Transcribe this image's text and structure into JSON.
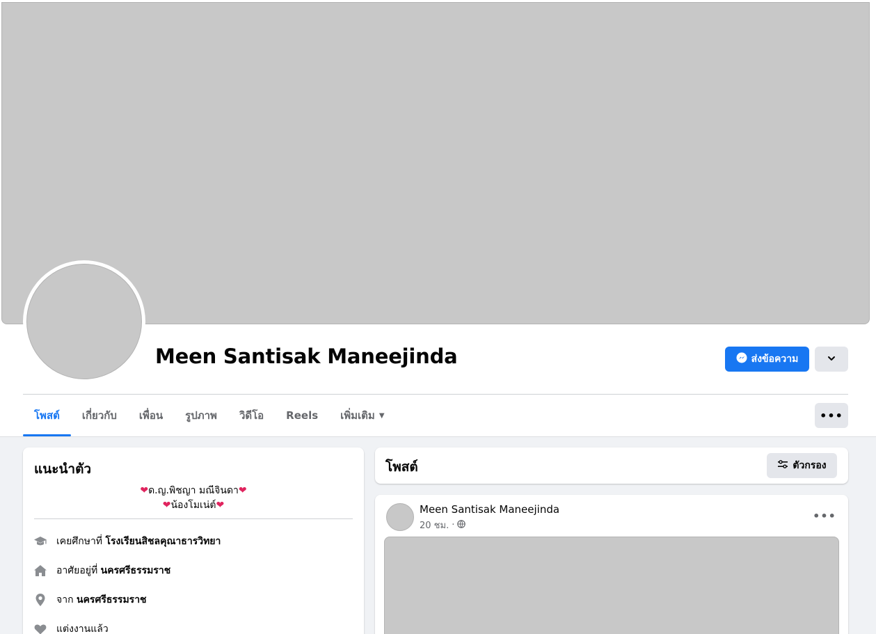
{
  "profile": {
    "name": "Meen Santisak Maneejinda",
    "message_button": "ส่งข้อความ",
    "cover_label": "Cover photo",
    "avatar_label": "Profile picture"
  },
  "tabs": [
    {
      "label": "โพสต์",
      "active": true
    },
    {
      "label": "เกี่ยวกับ",
      "active": false
    },
    {
      "label": "เพื่อน",
      "active": false
    },
    {
      "label": "รูปภาพ",
      "active": false
    },
    {
      "label": "วิดีโอ",
      "active": false
    },
    {
      "label": "Reels",
      "active": false
    },
    {
      "label": "เพิ่มเติม",
      "active": false
    }
  ],
  "intro": {
    "title": "แนะนำตัว",
    "bio_line1": "ด.ญ.พิชญา มณีจินดา",
    "bio_line2": "น้องโมเน่ต์",
    "rows": [
      {
        "icon": "education-icon",
        "prefix": "เคยศึกษาที่",
        "value": "โรงเรียนสิชลคุณาธารวิทยา"
      },
      {
        "icon": "home-icon",
        "prefix": "อาศัยอยู่ที่",
        "value": "นครศรีธรรมราช"
      },
      {
        "icon": "location-pin-icon",
        "prefix": "จาก",
        "value": "นครศรีธรรมราช"
      },
      {
        "icon": "heart-icon",
        "prefix": "แต่งงานแล้ว",
        "value": ""
      }
    ]
  },
  "posts": {
    "title": "โพสต์",
    "filter_button": "ตัวกรอง"
  },
  "post": {
    "author": "Meen Santisak Maneejinda",
    "time": "20 ชม.",
    "separator": "·",
    "media_label": "Post video"
  },
  "colors": {
    "accent": "#1877f2",
    "page_bg": "#f0f2f5",
    "button_gray": "#e4e6eb",
    "heart": "#e0245e"
  }
}
